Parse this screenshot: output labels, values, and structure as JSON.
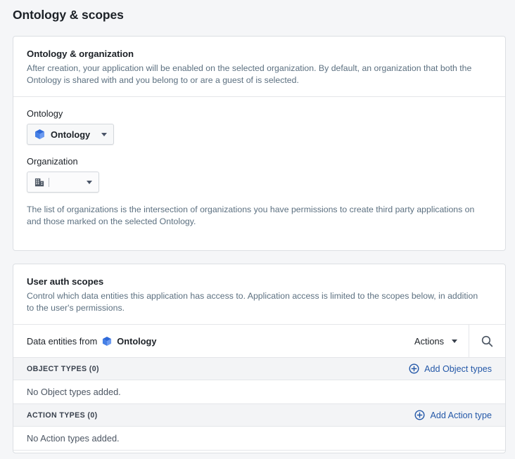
{
  "page": {
    "title": "Ontology & scopes"
  },
  "ontology_card": {
    "heading": "Ontology & organization",
    "description": "After creation, your application will be enabled on the selected organization. By default, an organization that both the Ontology is shared with and you belong to or are a guest of is selected.",
    "ontology_label": "Ontology",
    "ontology_value": "Ontology",
    "organization_label": "Organization",
    "organization_value": "",
    "helper": "The list of organizations is the intersection of organizations you have permissions to create third party applications on and those marked on the selected Ontology."
  },
  "scopes_card": {
    "heading": "User auth scopes",
    "description": "Control which data entities this application has access to. Application access is limited to the scopes below, in addition to the user's permissions.",
    "toolbar": {
      "source_prefix": "Data entities from",
      "source_name": "Ontology",
      "actions_label": "Actions",
      "search_icon": "search-icon"
    },
    "sections": [
      {
        "title": "OBJECT TYPES (0)",
        "add_label": "Add Object types",
        "empty_text": "No Object types added."
      },
      {
        "title": "ACTION TYPES (0)",
        "add_label": "Add Action type",
        "empty_text": "No Action types added."
      }
    ]
  },
  "colors": {
    "page_background": "#f5f6f8",
    "card_background": "#ffffff",
    "card_border": "#dcdfe3",
    "text_primary": "#1c2127",
    "text_muted": "#5c7080",
    "link_blue": "#2458a8",
    "cube_blue": "#4580e6",
    "section_header_background": "#f3f4f6"
  }
}
